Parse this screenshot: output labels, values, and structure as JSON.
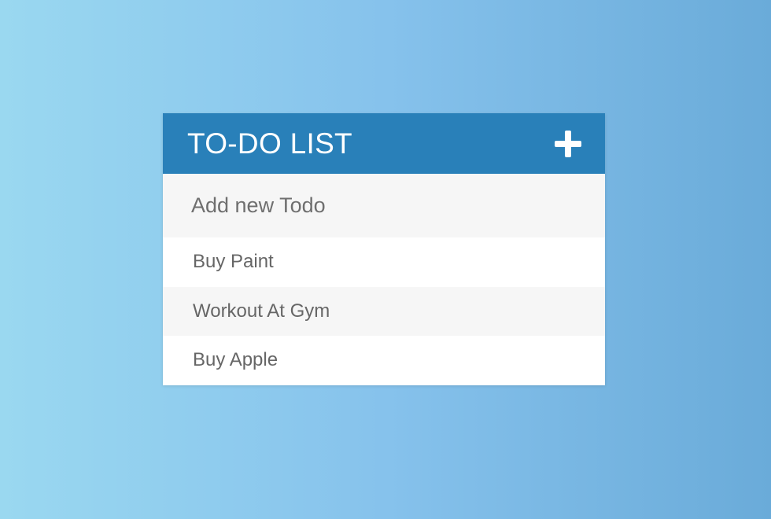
{
  "header": {
    "title": "TO-DO LIST",
    "add_icon": "plus-icon"
  },
  "new_todo": {
    "placeholder": "Add new Todo",
    "value": ""
  },
  "todos": [
    {
      "label": "Buy Paint"
    },
    {
      "label": "Workout At Gym"
    },
    {
      "label": "Buy Apple"
    }
  ],
  "colors": {
    "header_bg": "#2980b9",
    "input_bg": "#f6f6f6",
    "alt_row_bg": "#f6f6f6",
    "text": "#666666"
  }
}
